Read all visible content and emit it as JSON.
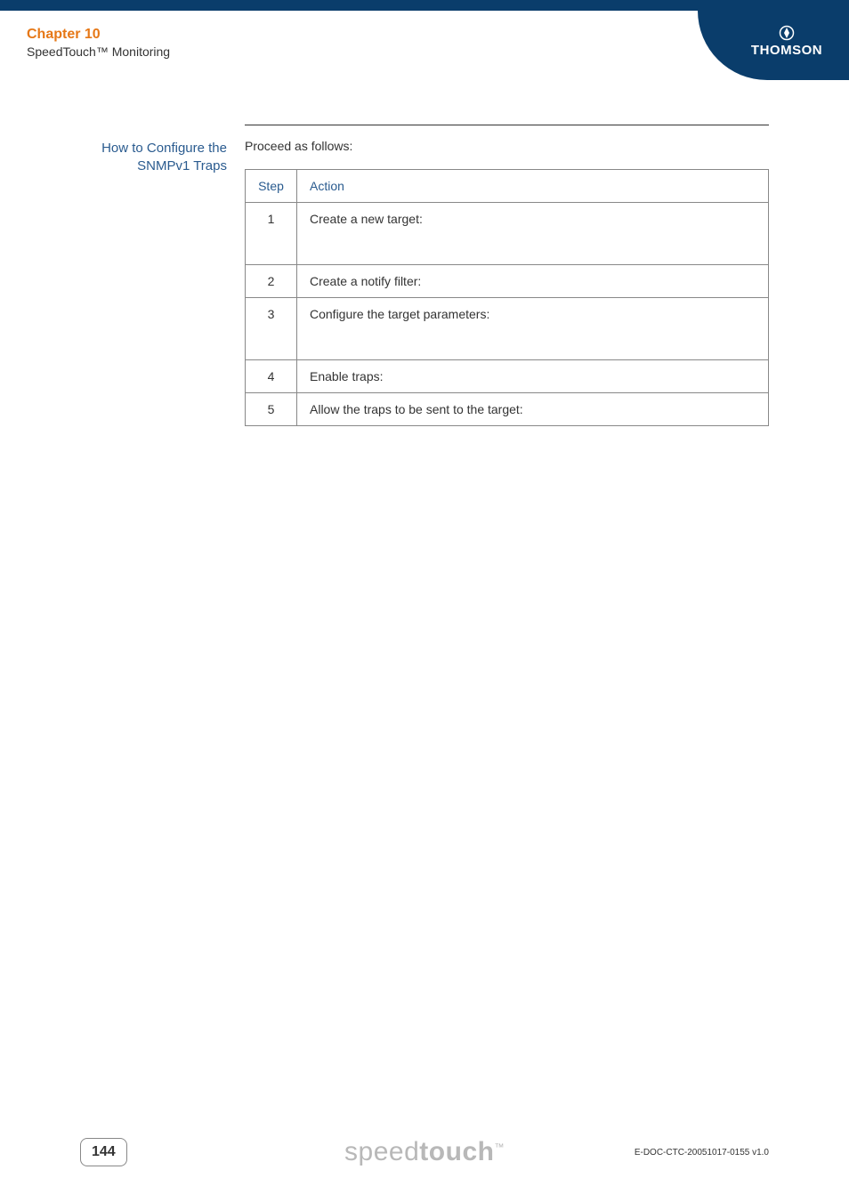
{
  "header": {
    "chapter_title": "Chapter 10",
    "chapter_subtitle": "SpeedTouch™ Monitoring",
    "brand": "THOMSON"
  },
  "content": {
    "side_heading_line1": "How to Configure the",
    "side_heading_line2": "SNMPv1 Traps",
    "intro": "Proceed as follows:",
    "table": {
      "headers": {
        "step": "Step",
        "action": "Action"
      },
      "rows": [
        {
          "step": "1",
          "action": "Create a new target:"
        },
        {
          "step": "2",
          "action": "Create a notify filter:"
        },
        {
          "step": "3",
          "action": "Configure the target parameters:"
        },
        {
          "step": "4",
          "action": "Enable traps:"
        },
        {
          "step": "5",
          "action": "Allow the traps to be sent to the target:"
        }
      ]
    }
  },
  "footer": {
    "page_number": "144",
    "logo_light": "speed",
    "logo_bold": "touch",
    "logo_tm": "™",
    "doc_id": "E-DOC-CTC-20051017-0155 v1.0"
  }
}
